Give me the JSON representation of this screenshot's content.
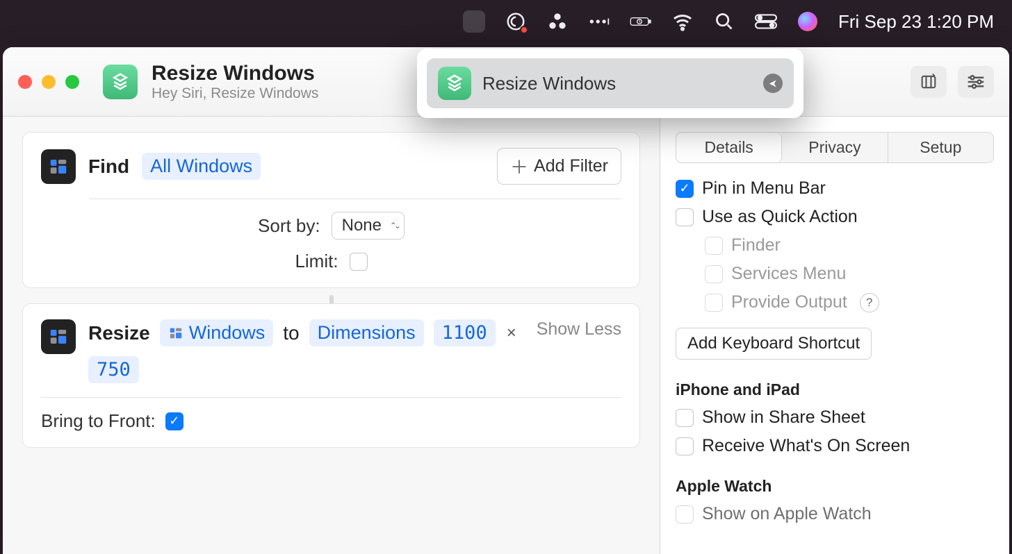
{
  "menubar": {
    "datetime": "Fri Sep 23  1:20 PM"
  },
  "window": {
    "title": "Resize Windows",
    "subtitle": "Hey Siri, Resize Windows"
  },
  "pinned": {
    "title": "Resize Windows"
  },
  "actions": {
    "find": {
      "verb": "Find",
      "target": "All Windows",
      "addFilter": "Add Filter",
      "sortByLabel": "Sort by:",
      "sortByValue": "None",
      "limitLabel": "Limit:"
    },
    "resize": {
      "verb": "Resize",
      "input": "Windows",
      "to": "to",
      "mode": "Dimensions",
      "width": "1100",
      "height": "750",
      "sep": "×",
      "showLess": "Show Less",
      "bringFrontLabel": "Bring to Front:"
    }
  },
  "inspector": {
    "tabs": {
      "details": "Details",
      "privacy": "Privacy",
      "setup": "Setup"
    },
    "pinMenu": "Pin in Menu Bar",
    "quickAction": "Use as Quick Action",
    "finder": "Finder",
    "services": "Services Menu",
    "provideOutput": "Provide Output",
    "addKbd": "Add Keyboard Shortcut",
    "iphoneHdr": "iPhone and iPad",
    "shareSheet": "Show in Share Sheet",
    "receive": "Receive What's On Screen",
    "watchHdr": "Apple Watch",
    "watchOpt": "Show on Apple Watch"
  }
}
